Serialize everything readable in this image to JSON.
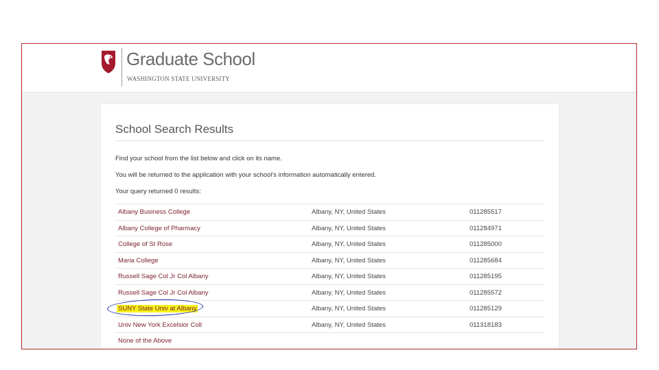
{
  "header": {
    "title": "Graduate School",
    "subtitle": "WASHINGTON STATE UNIVERSITY",
    "brand_color": "#a5192e"
  },
  "card": {
    "title": "School Search Results",
    "instruction": "Find your school from the list below and click on its name.",
    "return_note": "You will be returned to the application with your school's information automatically entered.",
    "result_count": "Your query returned 0 results:"
  },
  "results": [
    {
      "name": "Albany Business College",
      "location": "Albany, NY, United States",
      "code": "011285517"
    },
    {
      "name": "Albany College of Pharmacy",
      "location": "Albany, NY, United States",
      "code": "011284971"
    },
    {
      "name": "College of St Rose",
      "location": "Albany, NY, United States",
      "code": "011285000"
    },
    {
      "name": "Maria College",
      "location": "Albany, NY, United States",
      "code": "011285684"
    },
    {
      "name": "Russell Sage Col Jr Col Albany",
      "location": "Albany, NY, United States",
      "code": "011285195"
    },
    {
      "name": "Russell Sage Col Jr Col Albany",
      "location": "Albany, NY, United States",
      "code": "011285572"
    },
    {
      "name": "SUNY State Univ at Albany",
      "location": "Albany, NY, United States",
      "code": "011285129",
      "highlighted": true
    },
    {
      "name": "Univ New York Excelsior Coll",
      "location": "Albany, NY, United States",
      "code": "011318183"
    }
  ],
  "none_option": "None of the Above",
  "highlight_color": "#f7f21a",
  "annotation_color": "#1a2ea8"
}
